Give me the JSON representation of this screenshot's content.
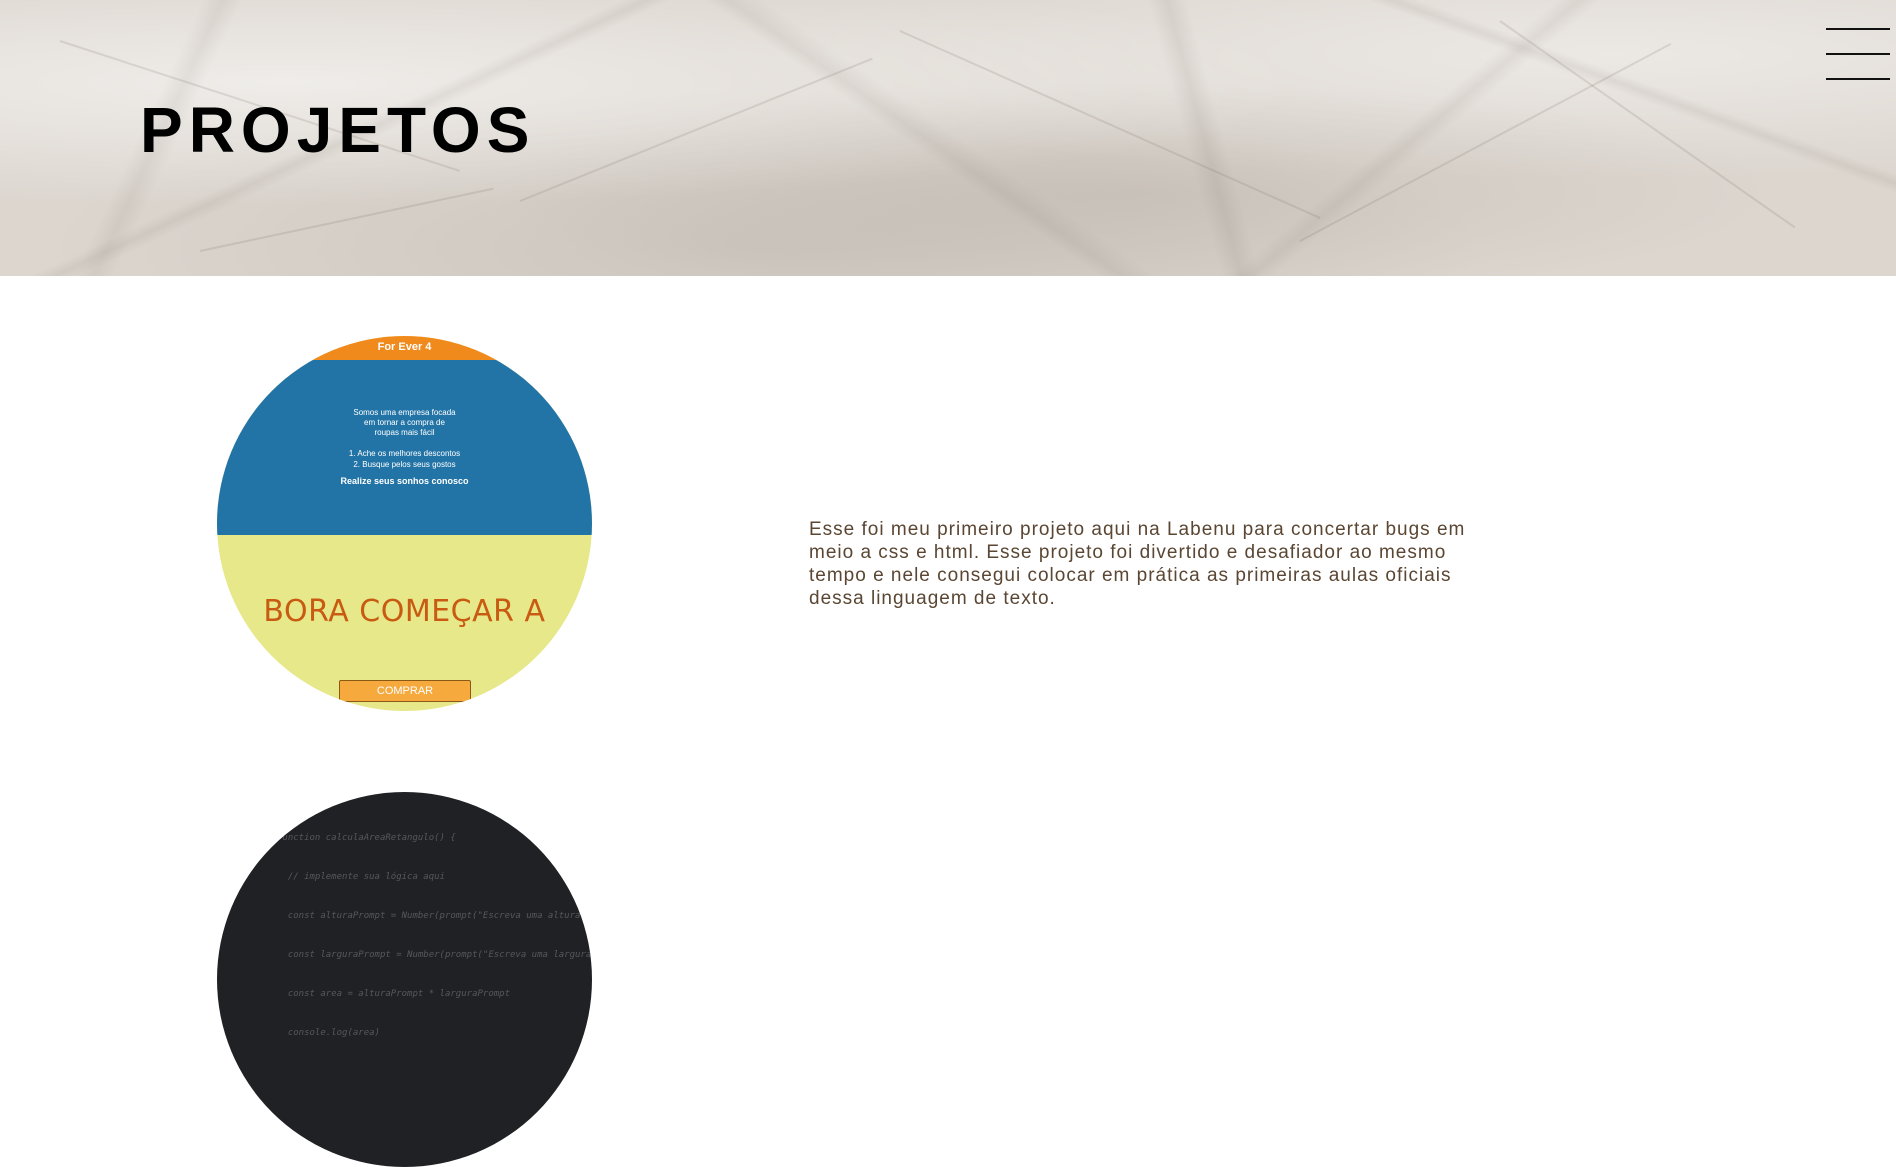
{
  "header": {
    "title": "PROJETOS",
    "menu_icon": "hamburger-menu-icon"
  },
  "projects": [
    {
      "thumbnail": {
        "brand": "For Ever 4",
        "intro_lines": [
          "Somos uma empresa focada",
          "em tornar a compra de",
          "roupas mais fácil"
        ],
        "list_items": [
          "1. Ache os melhores descontos",
          "2.    Busque pelos seus gostos"
        ],
        "cta": "Realize seus sonhos conosco",
        "headline": "BORA COMEÇAR A",
        "buy_label": "COMPRAR",
        "colors": {
          "top": "#f08a1d",
          "blue": "#2374a6",
          "yellow": "#e6e88a",
          "headline": "#c85a12",
          "button": "#f6a93c"
        }
      },
      "description": "Esse foi meu primeiro projeto aqui na Labenu para concertar bugs em meio a css e html. Esse projeto foi divertido e desafiador ao mesmo tempo e nele consegui colocar em prática as primeiras aulas oficiais dessa linguagem de texto."
    },
    {
      "thumbnail": {
        "code_lines": [
          "function calculaAreaRetangulo() {",
          "  // implemente sua lógica aqui",
          "  const alturaPrompt = Number(prompt(\"Escreva uma altura",
          "  const larguraPrompt = Number(prompt(\"Escreva uma largura",
          "  const area = alturaPrompt * larguraPrompt",
          "  console.log(area)"
        ],
        "colors": {
          "background": "#202124",
          "code": "#55585c"
        }
      }
    }
  ],
  "colors": {
    "title": "#000000",
    "description": "#5a4632",
    "paper": "#dcd6cf"
  }
}
